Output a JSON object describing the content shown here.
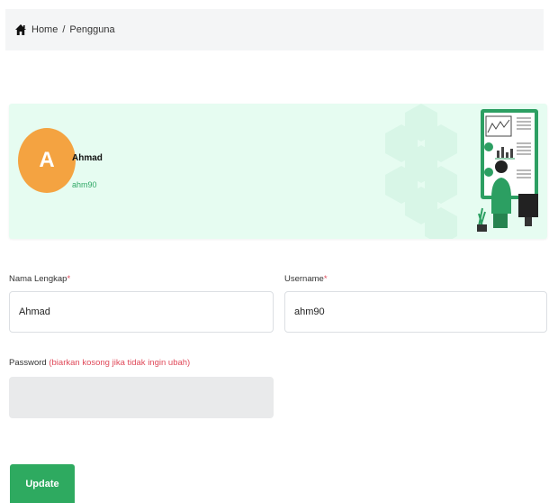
{
  "breadcrumb": {
    "home_label": "Home",
    "separator": "/",
    "current": "Pengguna"
  },
  "profile": {
    "avatar_initial": "A",
    "name": "Ahmad",
    "username": "ahm90",
    "avatar_color": "#f4a341",
    "card_bg": "#e6fcf1"
  },
  "form": {
    "full_name": {
      "label": "Nama Lengkap",
      "required": "*",
      "value": "Ahmad"
    },
    "username": {
      "label": "Username",
      "required": "*",
      "value": "ahm90"
    },
    "password": {
      "label": "Password",
      "hint": "(biarkan kosong jika tidak ingin ubah)",
      "value": ""
    }
  },
  "actions": {
    "update_label": "Update",
    "accent": "#2eaa60"
  },
  "icons": {
    "home": "home-icon"
  }
}
